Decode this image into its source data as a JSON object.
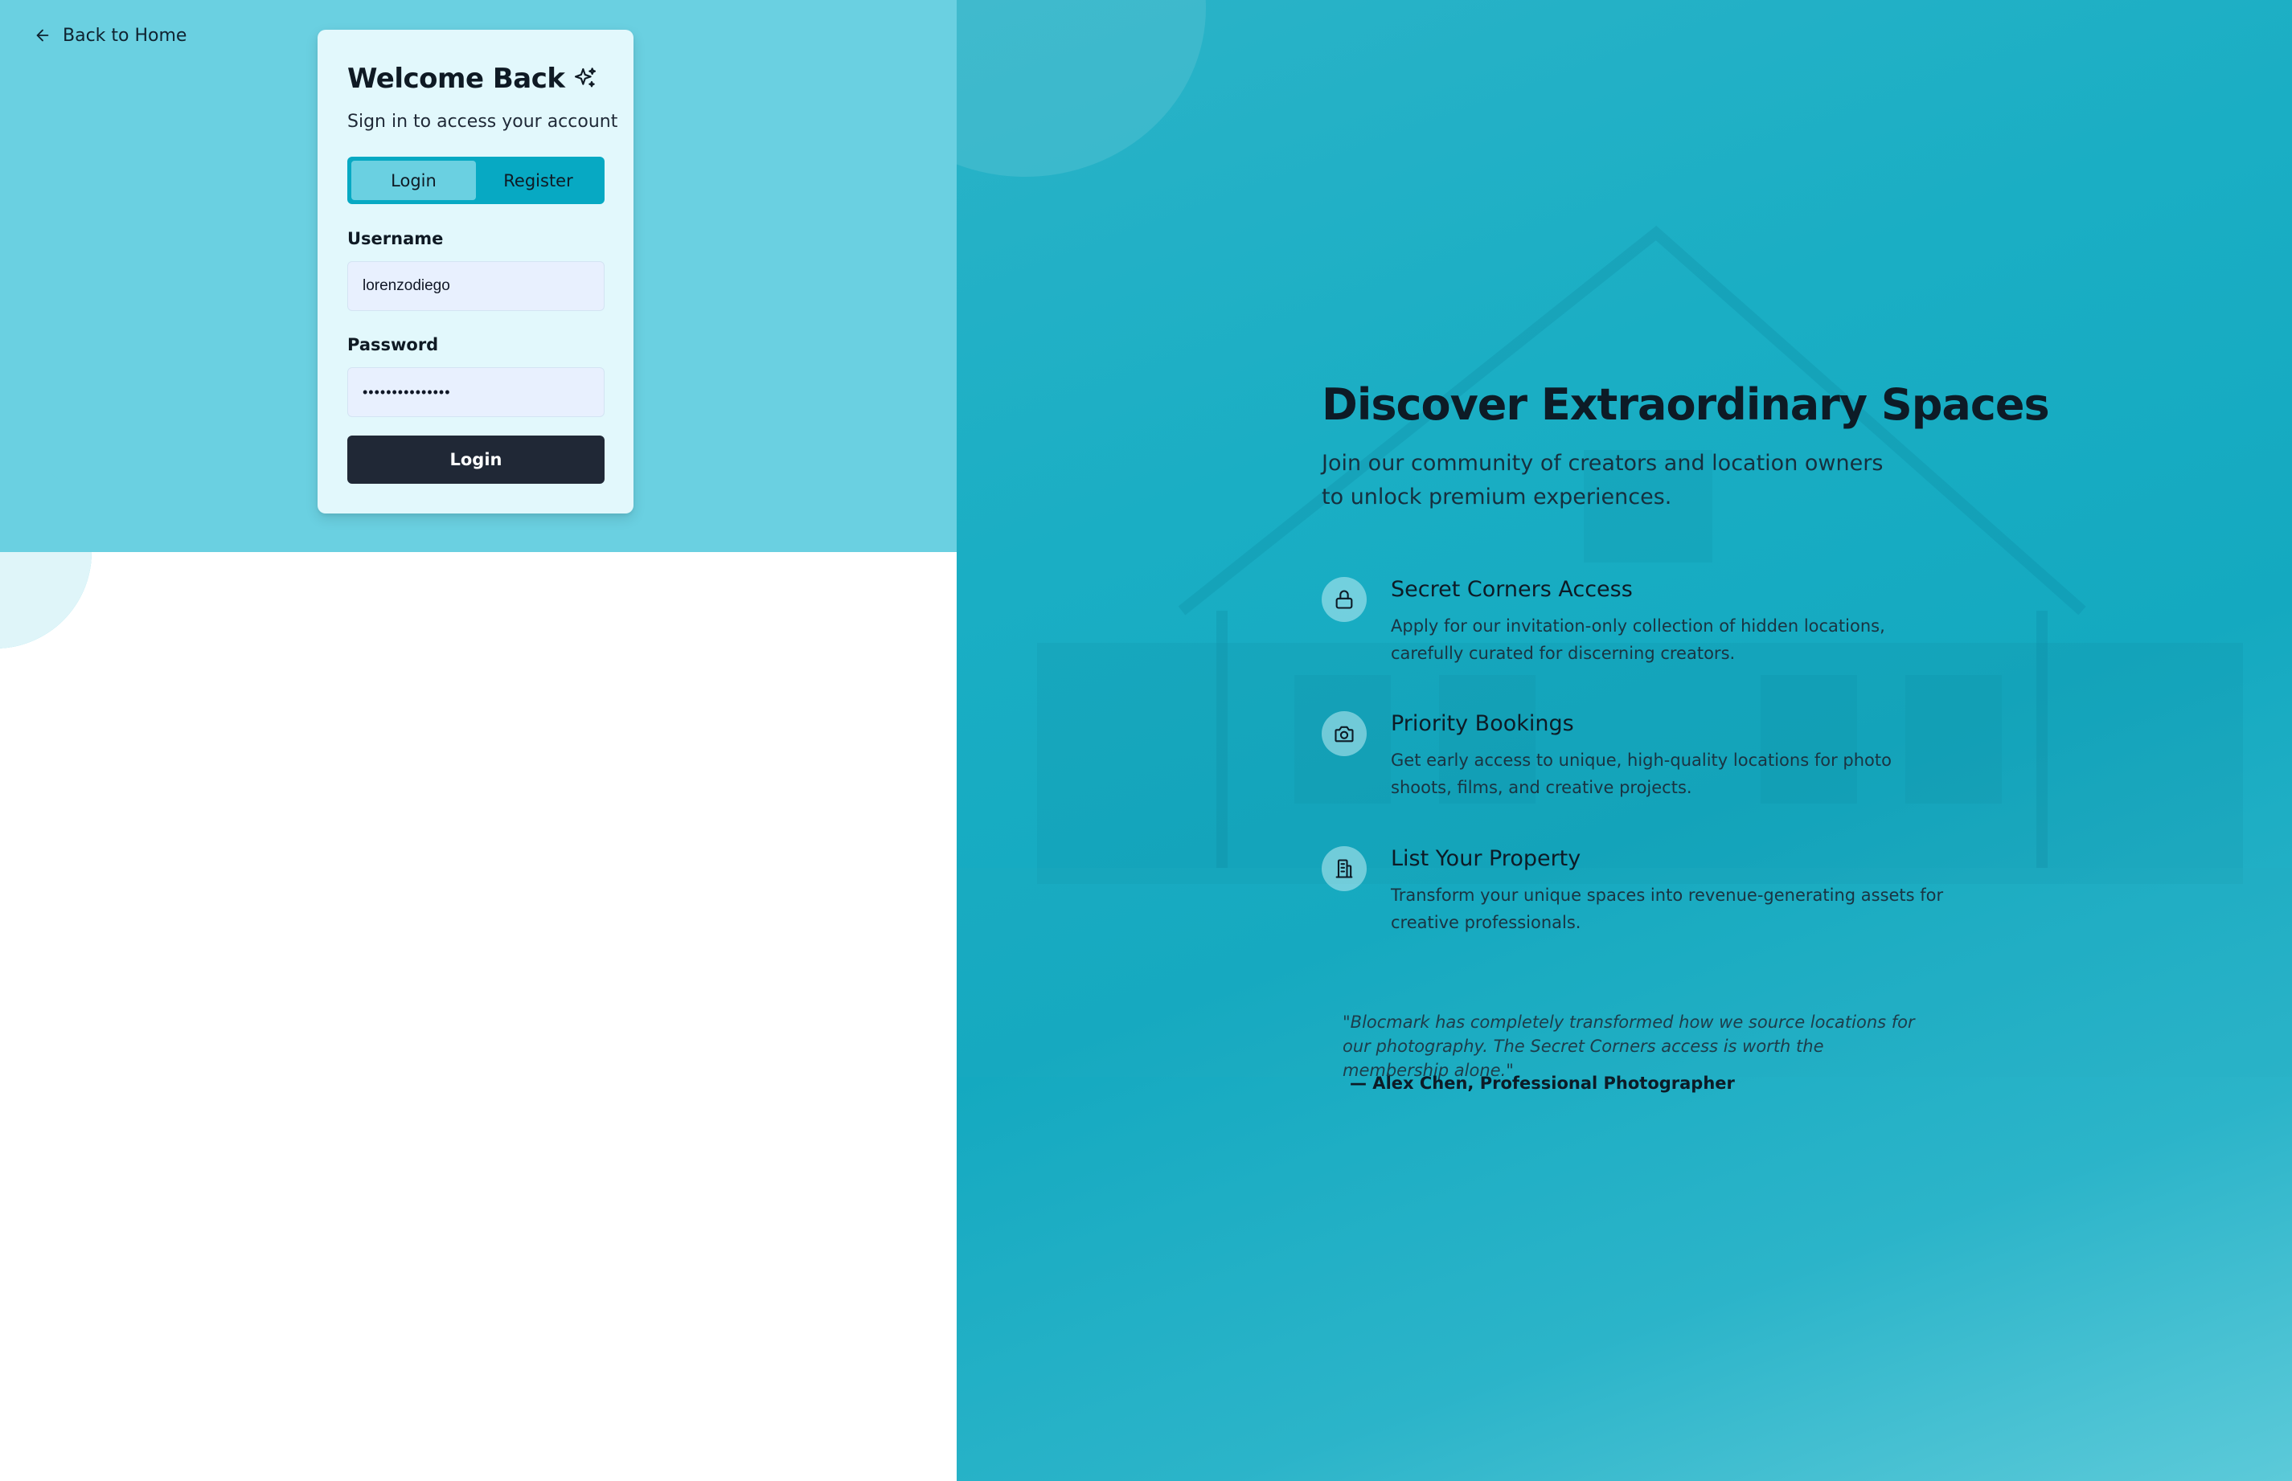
{
  "nav": {
    "back_label": "Back to Home"
  },
  "auth_card": {
    "title": "Welcome Back",
    "subtitle": "Sign in to access your account",
    "tabs": [
      {
        "label": "Login",
        "active": true
      },
      {
        "label": "Register",
        "active": false
      }
    ],
    "username": {
      "label": "Username",
      "value": "lorenzodiego"
    },
    "password": {
      "label": "Password",
      "value": "•••••••••••••••"
    },
    "submit_label": "Login"
  },
  "hero": {
    "title": "Discover Extraordinary Spaces",
    "subtitle": "Join our community of creators and location owners to unlock premium experiences.",
    "features": [
      {
        "icon": "lock-icon",
        "title": "Secret Corners Access",
        "description": "Apply for our invitation-only collection of hidden locations, carefully curated for discerning creators."
      },
      {
        "icon": "camera-icon",
        "title": "Priority Bookings",
        "description": "Get early access to unique, high-quality locations for photo shoots, films, and creative projects."
      },
      {
        "icon": "building-icon",
        "title": "List Your Property",
        "description": "Transform your unique spaces into revenue-generating assets for creative professionals."
      }
    ],
    "testimonial": {
      "quote": "\"Blocmark has completely transformed how we source locations for our photography. The Secret Corners access is worth the membership alone.\"",
      "author": "— Alex Chen, Professional Photographer"
    }
  },
  "colors": {
    "left_band": "#6ad0e1",
    "card_bg": "#e2f8fc",
    "tab_bar": "#07a9c3",
    "tab_active": "#6ad0e1",
    "primary_button": "#202836",
    "right_panel": "#14a9c0"
  }
}
